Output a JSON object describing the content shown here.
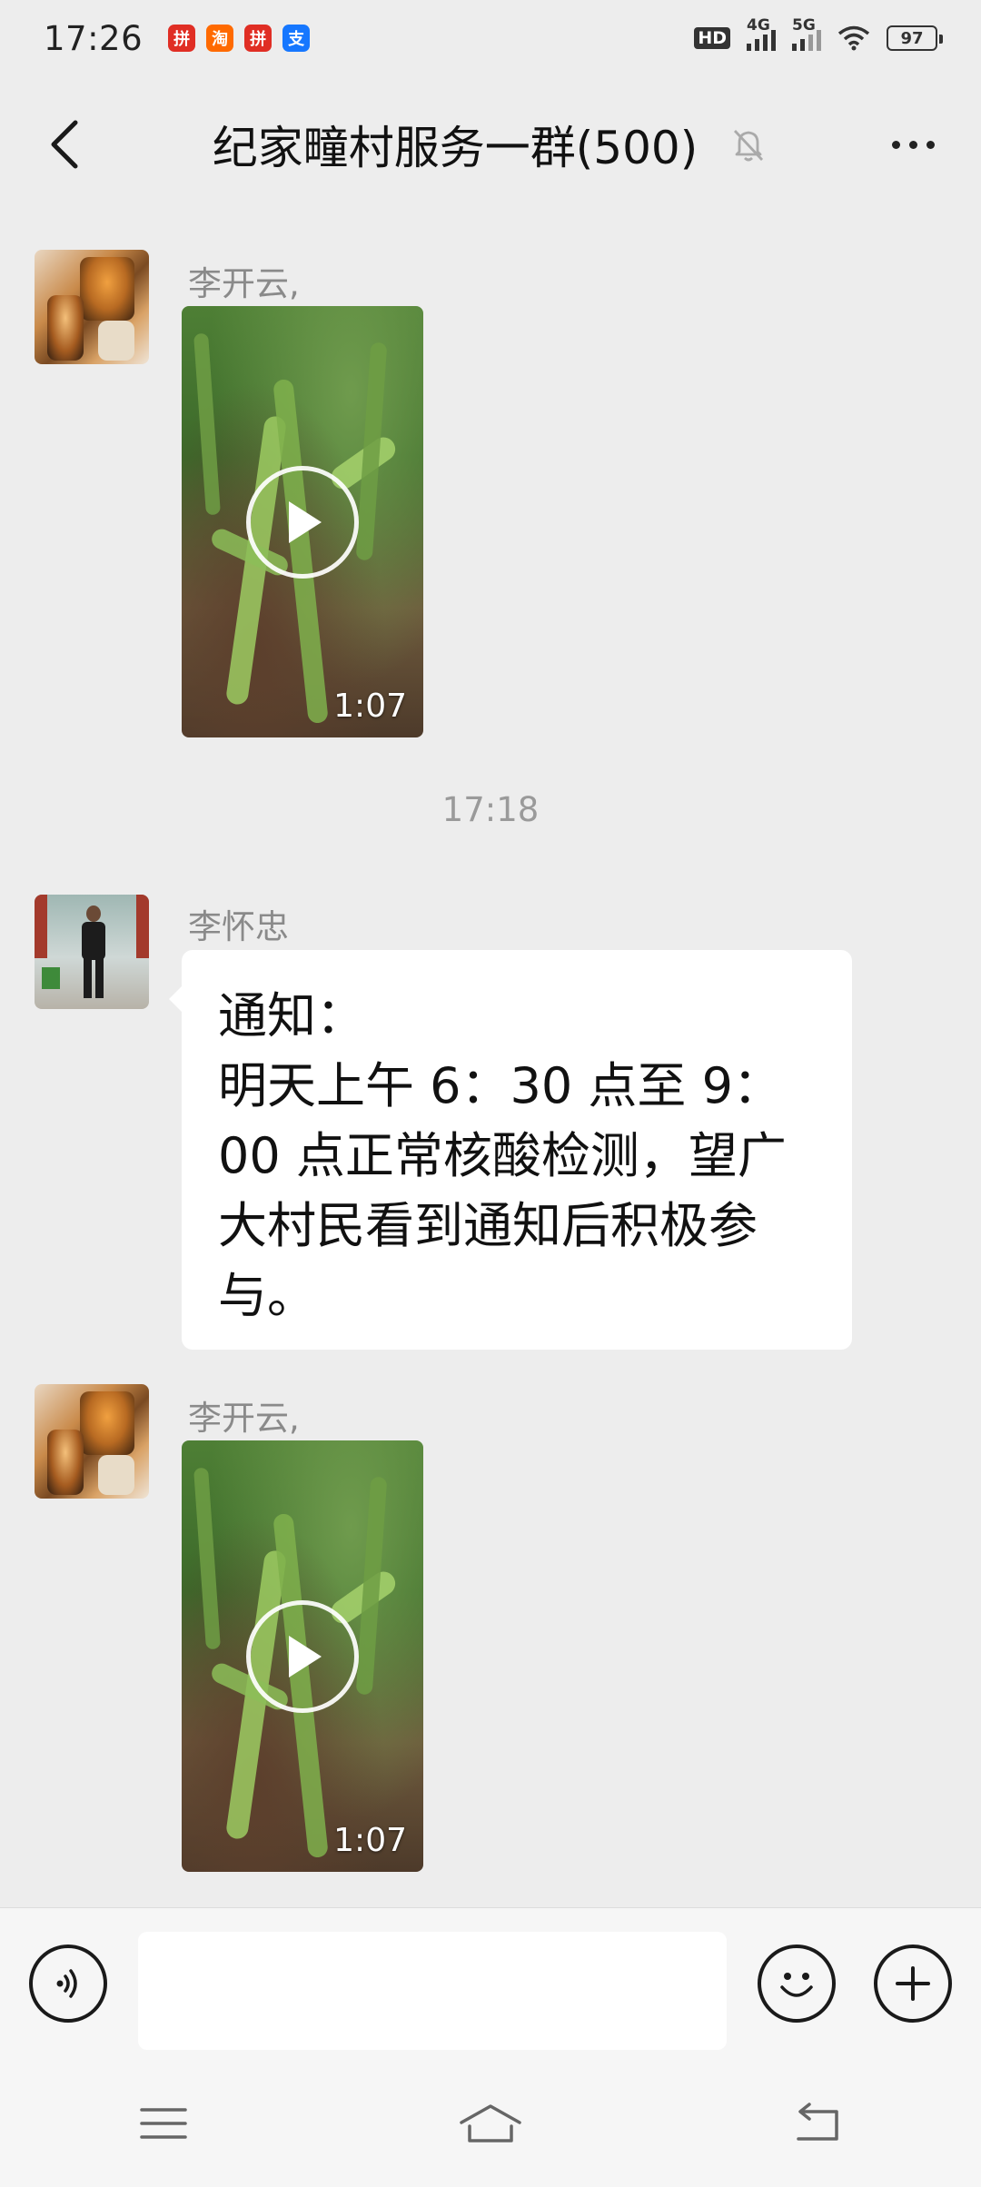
{
  "status_bar": {
    "time": "17:26",
    "apps": [
      {
        "icon": "pinduoduo-icon",
        "color": "#e02e24",
        "glyph": "拼"
      },
      {
        "icon": "taobao-icon",
        "color": "#ff6a00",
        "glyph": "淘"
      },
      {
        "icon": "pinduoduo-618-icon",
        "color": "#e02e24",
        "glyph": "拼"
      },
      {
        "icon": "alipay-icon",
        "color": "#1677ff",
        "glyph": "支"
      }
    ],
    "hd_label": "HD",
    "signal_4g_label": "4G",
    "signal_5g_label": "5G",
    "battery": "97"
  },
  "header": {
    "title": "纪家疃村服务一群(500)",
    "back_icon": "chevron-left-icon",
    "mute_icon": "bell-off-icon",
    "more_icon": "more-dots-icon"
  },
  "messages": [
    {
      "sender": "李开云,",
      "type": "video",
      "duration": "1:07"
    },
    {
      "type": "time",
      "text": "17:18"
    },
    {
      "sender": "李怀忠",
      "type": "text",
      "lines": [
        "通知：",
        "明天上午 6：30 点至 9：",
        "00 点正常核酸检测，望广",
        "大村民看到通知后积极参",
        "与。"
      ]
    },
    {
      "sender": "李开云,",
      "type": "video",
      "duration": "1:07"
    }
  ],
  "input_bar": {
    "voice_icon": "voice-icon",
    "emoji_icon": "emoji-icon",
    "plus_icon": "plus-icon",
    "placeholder": ""
  },
  "nav_bar": {
    "menu_icon": "menu-icon",
    "home_icon": "home-icon",
    "back_icon": "back-arrow-icon"
  }
}
